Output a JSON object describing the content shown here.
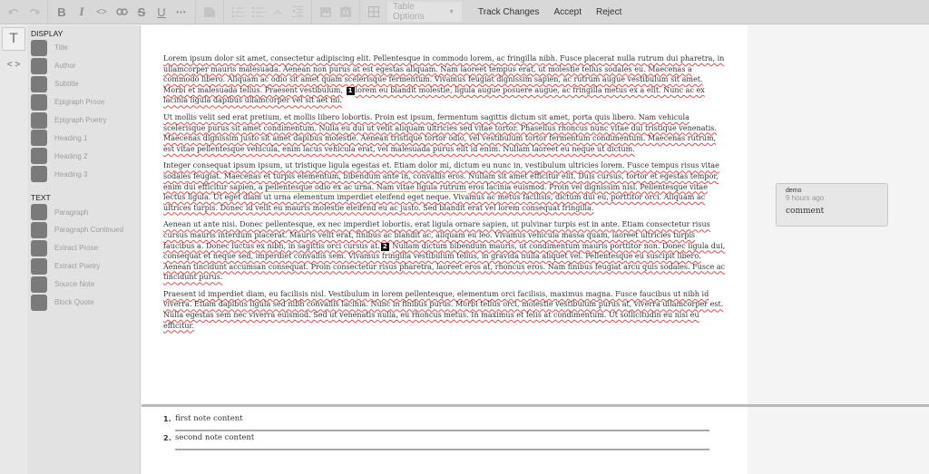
{
  "toolbar": {
    "history": [
      {
        "name": "undo-icon",
        "glyph": "↶"
      },
      {
        "name": "redo-icon",
        "glyph": "↷"
      }
    ],
    "formatting": [
      {
        "name": "bold-icon",
        "glyph": "B"
      },
      {
        "name": "italic-icon",
        "glyph": "I"
      },
      {
        "name": "code-icon",
        "glyph": "<>"
      },
      {
        "name": "link-icon",
        "glyph": "⛓"
      },
      {
        "name": "strikethrough-icon",
        "glyph": "S"
      },
      {
        "name": "underline-icon",
        "glyph": "U"
      },
      {
        "name": "more-icon",
        "glyph": "•••"
      }
    ],
    "table_options_label": "Table Options",
    "track_changes_label": "Track Changes",
    "accept_label": "Accept",
    "reject_label": "Reject"
  },
  "mode_tabs": [
    {
      "name": "text-mode-icon",
      "glyph": "T",
      "active": true
    },
    {
      "name": "code-mode-icon",
      "glyph": "<>",
      "active": false
    }
  ],
  "styles_panel": {
    "display_title": "DISPLAY",
    "display_items": [
      "Title",
      "Author",
      "Subtitle",
      "Epigraph Prose",
      "Epigraph Poetry",
      "Heading 1",
      "Heading 2",
      "Heading 3"
    ],
    "text_title": "TEXT",
    "text_items": [
      "Paragraph",
      "Paragraph Continued",
      "Extract Prose",
      "Extract Poetry",
      "Source Note",
      "Block Quote"
    ]
  },
  "document": {
    "p1_a": "Lorem ipsum dolor sit amet, consectetur adipiscing elit. Pellentesque in commodo lorem, ac fringilla nibh. Fusce placerat nulla rutrum dui pharetra, in ullamcorper mauris malesuada. Aenean non purus at est egestas aliquam. Nam laoreet tempus erat, ut molestie tellus sodales eu. Maecenas a commodo libero. Aliquam ac odio sit amet quam scelerisque fermentum. Vivamus feugiat dignissim sapien, ac rutrum augue vestibulum sit amet. Morbi et malesuada tellus. Praesent vestibulum,",
    "p1_marker": "1",
    "p1_b": "lorem eu blandit molestie, ligula augue posuere augue, ac fringilla metus ex a elit. Nunc ac ex lacinia ligula dapibus ullamcorper vel sit aet mi.",
    "p2": "Ut mollis velit sed erat pretium, et mollis libero lobortis. Proin est ipsum, fermentum sagittis dictum sit amet, porta quis libero. Nam vehicula scelerisque purus sit amet condimentum. Nulla eu dui ut velit aliquam ultricies sed vitae tortor. Phasellus rhoncus nunc vitae dui tristique venenatis. Maecenas dignissim justo sit amet dapibus molestie. Aenean tristique tortor odio, vel vestibulum tortor fermentum condimentum. Maecenas rutrum, est vitae pellentesque vehicula, enim lacus vehicula erat, vel malesuada purus elit id enim. Nullam laoreet eu neque ut dictum.",
    "p3_a": "Integer consequat ipsum ipsum, ut tristique ligula egestas et. Etiam dolor mi, dictum eu nunc in, vestibulum ultricies lorem. Fusce tempus risus vitae sodales feugiat. Maecenas et turpis elementum, bibendum ante in, convallis eros. Nullam sit amet efficitur elit. Duis cursus, tortor et egestas tempor, enim dui efficitur sapien, a",
    "p3_tracked": "pellentesque odio ex ac urna. Nam vitae ligula rutrum",
    "p3_b": "eros lacinia euismod. Proin vel dignissim nisl. Pellentesque vitae lectus ligula. Ut eget diam ut urna elementum imperdiet eleifend eget neque. Vivamus ac metus facilisis, dictum dui eu, porttitor orci. Aliquam ac ultrices turpis. Donec id velit eu mauris molestie eleifend eu ac justo. Sed blandit erat vel lorem consequat fringilla.",
    "p4_a": "Aenean ut ante nisi. Donec pellentesque, ex nec imperdiet lobortis, erat ligula ornare sapien, ut pulvinar turpis est in ante. Etiam consectetur risus cursus mauris interdum placerat. Mauris velit erat, finibus ac blandit ac, aliquam eu leo. Vivamus vehicula massa quam, laoreet ultricies turpis faucibus a. Donec luctus ex nibh, in sagittis orci cursus at.",
    "p4_marker": "2",
    "p4_b": "Nullam dictum bibendum mauris, ut condimentum mauris porttitor non. Donec ligula dui, consequat et neque sed, imperdiet convallis sem. Vivamus fringilla vestibulum tellus, in gravida nulla aliquet vel. Pellentesque eu suscipit libero. Aenean tincidunt accumsan consequat. Proin consectetur risus pharetra, laoreet eros at, rhoncus eros. Nam finibus feugiat arcu quis sodales. Fusce ac tincidunt purus.",
    "p5": "Praesent id imperdiet diam, eu facilisis nisl. Vestibulum in lorem pellentesque, elementum orci facilisis, maximus magna. Fusce faucibus ut nibh id viverra. Etiam dapibus ligula sed nibh convallis lacinia. Nunc in finibus purus. Morbi tellus orci, molestie vestibulum purus at, viverra ullamcorper est. Nulla egestas sem nec viverra euismod. Sed ut venenatis nulla, eu rhoncus metus. In maximus et felis at condimentum. Ut sollicitudin eu nisi eu efficitur."
  },
  "comment": {
    "author": "demo",
    "time": "9 hours ago",
    "text": "comment"
  },
  "notes": [
    {
      "number": "1.",
      "content": "first note content"
    },
    {
      "number": "2.",
      "content": "second note content"
    }
  ],
  "colors": {
    "toolbar_bg": "#d8d8d8",
    "panel_bg": "#e2e2e2",
    "swatch": "#7a7a7a",
    "spellcheck": "#e34b4b",
    "track_change": "#e8b900"
  }
}
